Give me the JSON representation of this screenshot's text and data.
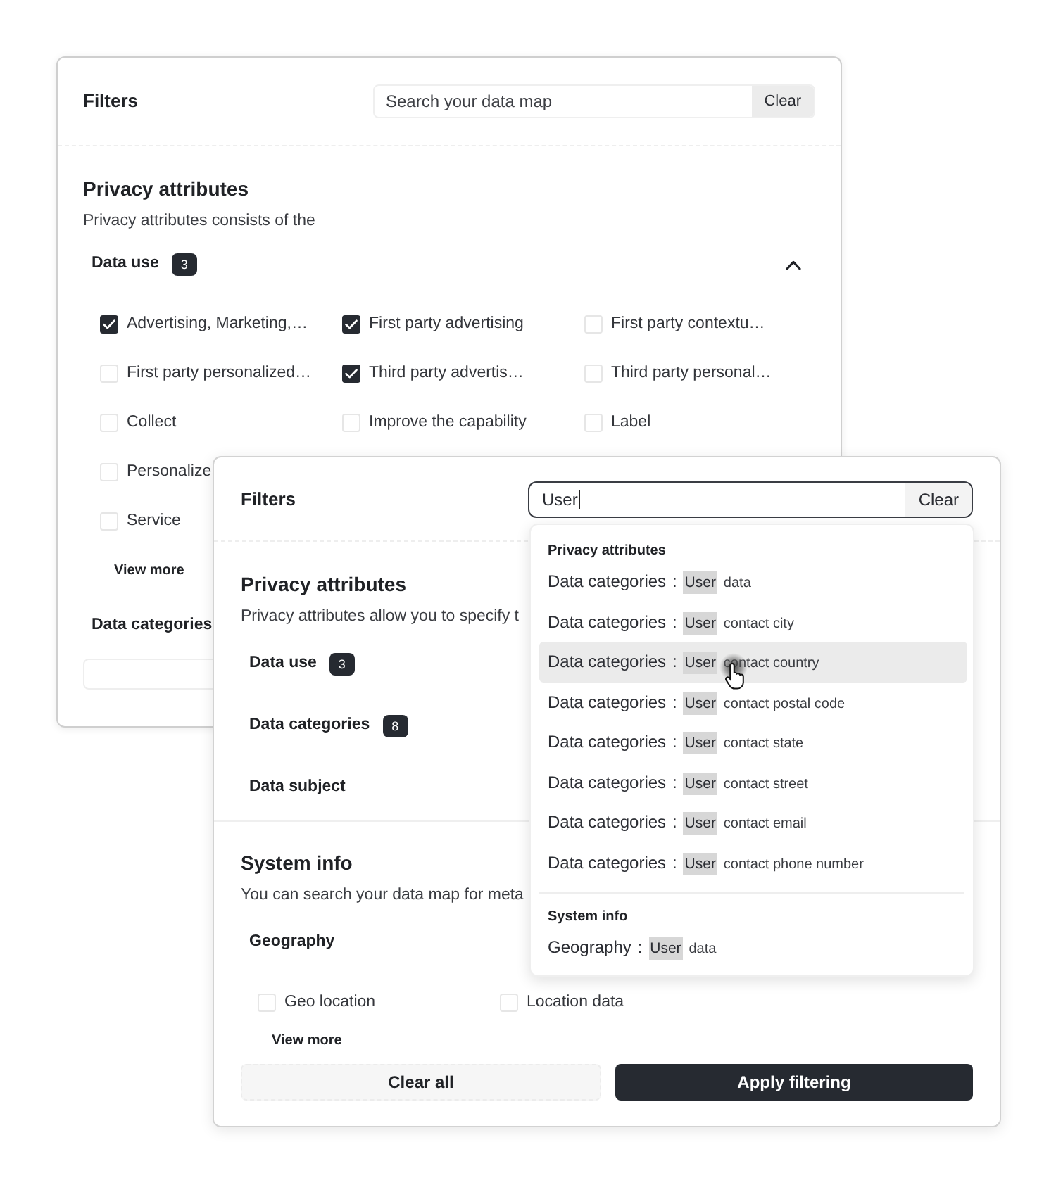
{
  "back_panel": {
    "title": "Filters",
    "search": {
      "placeholder": "Search your data map",
      "focused": false,
      "clear_label": "Clear"
    },
    "sections": [
      {
        "title": "Privacy attributes",
        "description": "Privacy attributes consists of the",
        "groups": [
          {
            "label": "Data use",
            "count": "3",
            "expanded": true,
            "option_rows": [
              [
                {
                  "label": "Advertising, Marketing,…",
                  "checked": true
                },
                {
                  "label": "First party advertising",
                  "checked": true
                },
                {
                  "label": "First party contextu…",
                  "checked": false
                }
              ],
              [
                {
                  "label": "First party personalized…",
                  "checked": false
                },
                {
                  "label": "Third party advertis…",
                  "checked": true
                },
                {
                  "label": "Third party personal…",
                  "checked": false
                }
              ],
              [
                {
                  "label": "Collect",
                  "checked": false
                },
                {
                  "label": "Improve the capability",
                  "checked": false
                },
                {
                  "label": "Label",
                  "checked": false
                }
              ],
              [
                {
                  "label": "Personalize",
                  "checked": false
                }
              ],
              [
                {
                  "label": "Service",
                  "checked": false
                }
              ]
            ],
            "view_more": "View more"
          },
          {
            "label": "Data categories",
            "input_field": true
          }
        ]
      }
    ]
  },
  "front_panel": {
    "title": "Filters",
    "search": {
      "value": "User",
      "focused": true,
      "clear_label": "Clear"
    },
    "sections": [
      {
        "title": "Privacy attributes",
        "description": "Privacy attributes allow you to specify t",
        "groups": [
          {
            "label": "Data use",
            "count": "3"
          },
          {
            "label": "Data categories",
            "count": "8"
          },
          {
            "label": "Data subject"
          }
        ]
      },
      {
        "title": "System info",
        "description": "You can search your data map for meta",
        "groups": [
          {
            "label": "Geography",
            "option_rows": [
              [
                {
                  "label": "Geo location",
                  "checked": false
                },
                {
                  "label": "Location data",
                  "checked": false
                }
              ]
            ],
            "view_more": "View more"
          }
        ]
      }
    ],
    "actions": [
      {
        "label": "Clear all",
        "kind": "secondary"
      },
      {
        "label": "Apply filtering",
        "kind": "primary"
      }
    ]
  },
  "search_dropdown": {
    "groups": [
      {
        "title": "Privacy attributes",
        "results": [
          {
            "field": "Data categories",
            "separator": ":",
            "match": "User",
            "rest": "data",
            "highlighted": false
          },
          {
            "field": "Data categories",
            "separator": ":",
            "match": "User",
            "rest": "contact city",
            "highlighted": false
          },
          {
            "field": "Data categories",
            "separator": ":",
            "match": "User",
            "rest": "contact country",
            "highlighted": true
          },
          {
            "field": "Data categories",
            "separator": ":",
            "match": "User",
            "rest": "contact postal code",
            "highlighted": false
          },
          {
            "field": "Data categories",
            "separator": ":",
            "match": "User",
            "rest": "contact state",
            "highlighted": false
          },
          {
            "field": "Data categories",
            "separator": ":",
            "match": "User",
            "rest": "contact street",
            "highlighted": false
          },
          {
            "field": "Data categories",
            "separator": ":",
            "match": "User",
            "rest": "contact email",
            "highlighted": false
          },
          {
            "field": "Data categories",
            "separator": ":",
            "match": "User",
            "rest": "contact phone number",
            "highlighted": false
          }
        ]
      },
      {
        "title": "System info",
        "results": [
          {
            "field": "Geography",
            "separator": ":",
            "match": "User",
            "rest": "data",
            "highlighted": false
          }
        ]
      }
    ]
  }
}
